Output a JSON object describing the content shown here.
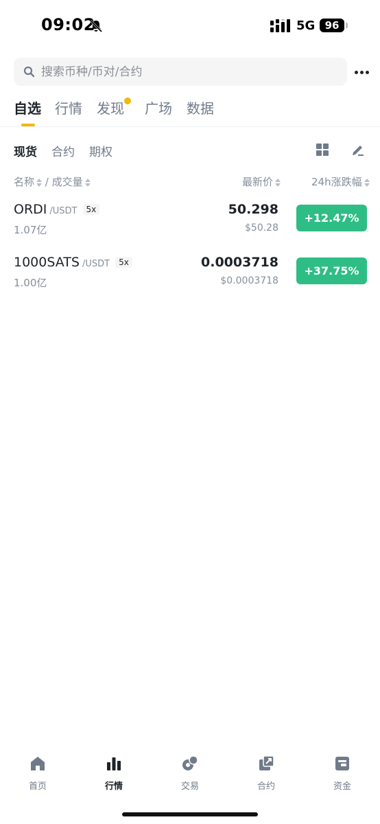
{
  "status_bar": {
    "time": "09:02",
    "network": "5G",
    "battery": "96"
  },
  "search": {
    "placeholder": "搜索币种/币对/合约"
  },
  "main_tabs": [
    {
      "label": "自选",
      "active": true
    },
    {
      "label": "行情"
    },
    {
      "label": "发现",
      "badge_dot": true
    },
    {
      "label": "广场"
    },
    {
      "label": "数据"
    }
  ],
  "sub_tabs": [
    {
      "label": "现货",
      "active": true
    },
    {
      "label": "合约"
    },
    {
      "label": "期权"
    }
  ],
  "columns": {
    "name": "名称",
    "separator": "/",
    "volume": "成交量",
    "last_price": "最新价",
    "change": "24h涨跌幅"
  },
  "rows": [
    {
      "base": "ORDI",
      "quote": "/USDT",
      "leverage": "5x",
      "volume": "1.07亿",
      "price": "50.298",
      "fiat_price": "$50.28",
      "change": "+12.47%"
    },
    {
      "base": "1000SATS",
      "quote": "/USDT",
      "leverage": "5x",
      "volume": "1.00亿",
      "price": "0.0003718",
      "fiat_price": "$0.0003718",
      "change": "+37.75%"
    }
  ],
  "bottom_nav": [
    {
      "label": "首页",
      "icon": "home-icon"
    },
    {
      "label": "行情",
      "icon": "markets-icon",
      "active": true
    },
    {
      "label": "交易",
      "icon": "trade-icon"
    },
    {
      "label": "合约",
      "icon": "futures-icon"
    },
    {
      "label": "资金",
      "icon": "wallet-icon"
    }
  ],
  "colors": {
    "accent": "#f0b90b",
    "up": "#2ebd85",
    "text": "#1e2329",
    "muted": "#848e9c"
  }
}
